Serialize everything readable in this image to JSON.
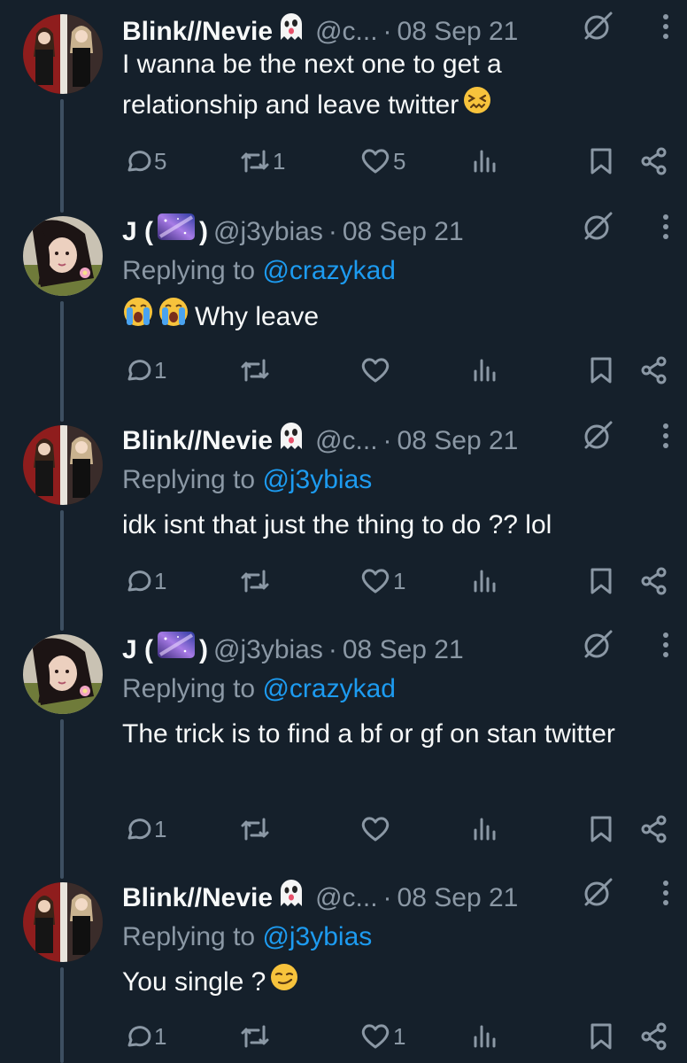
{
  "tweets": [
    {
      "name": "Blink//Nevie",
      "name_emoji": "ghost",
      "handle": "@c...",
      "dot": "·",
      "date": "08 Sep 21",
      "replying_to_label": "",
      "replying_to": "",
      "text": "I wanna be the next one to get a relationship and leave twitter",
      "text_emoji": "confounded-face",
      "reply_count": "5",
      "retweet_count": "1",
      "like_count": "5"
    },
    {
      "name": "J (",
      "name_suffix": ")",
      "name_emoji": "milky-way",
      "handle": "@j3ybias",
      "dot": "·",
      "date": "08 Sep 21",
      "replying_to_label": "Replying to",
      "replying_to": "@crazykad",
      "text_emoji_prefix": "crying-faces",
      "text": "Why leave",
      "reply_count": "1",
      "retweet_count": "",
      "like_count": ""
    },
    {
      "name": "Blink//Nevie",
      "name_emoji": "ghost",
      "handle": "@c...",
      "dot": "·",
      "date": "08 Sep 21",
      "replying_to_label": "Replying to",
      "replying_to": "@j3ybias",
      "text": "idk isnt that just the thing to do ?? lol",
      "reply_count": "1",
      "retweet_count": "",
      "like_count": "1"
    },
    {
      "name": "J (",
      "name_suffix": ")",
      "name_emoji": "milky-way",
      "handle": "@j3ybias",
      "dot": "·",
      "date": "08 Sep 21",
      "replying_to_label": "Replying to",
      "replying_to": "@crazykad",
      "text": "The trick is to find a bf or gf on stan twitter",
      "reply_count": "1",
      "retweet_count": "",
      "like_count": ""
    },
    {
      "name": "Blink//Nevie",
      "name_emoji": "ghost",
      "handle": "@c...",
      "dot": "·",
      "date": "08 Sep 21",
      "replying_to_label": "Replying to",
      "replying_to": "@j3ybias",
      "text": "You single ?",
      "text_emoji": "smirking-face",
      "reply_count": "1",
      "retweet_count": "",
      "like_count": "1"
    }
  ],
  "colors": {
    "background": "#15202b",
    "primary_text": "#f7f9f9",
    "secondary_text": "#8b98a5",
    "link": "#1d9bf0",
    "thread_line": "#3d4f61"
  },
  "icons": [
    "reply-icon",
    "retweet-icon",
    "like-icon",
    "views-icon",
    "bookmark-icon",
    "share-icon",
    "grok-icon",
    "more-icon"
  ]
}
